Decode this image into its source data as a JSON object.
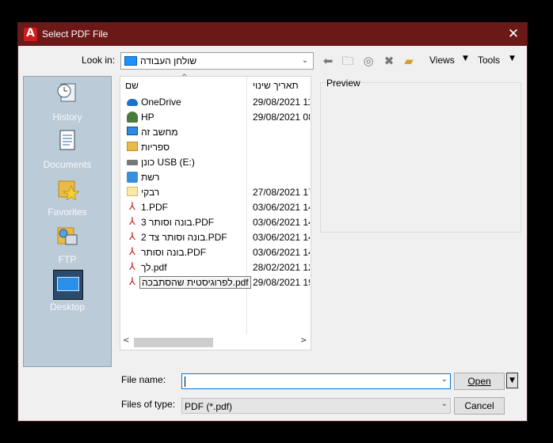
{
  "window": {
    "title": "Select PDF File",
    "close_glyph": "✕"
  },
  "toolbar": {
    "lookin_label": "Look in:",
    "lookin_value": "שולחן העבודה",
    "views_label": "Views",
    "tools_label": "Tools",
    "icons": [
      "back-icon",
      "up-folder-icon",
      "search-web-icon",
      "delete-icon",
      "new-folder-icon"
    ]
  },
  "places": [
    {
      "label": "History",
      "icon": "history-icon"
    },
    {
      "label": "Documents",
      "icon": "documents-icon"
    },
    {
      "label": "Favorites",
      "icon": "favorites-icon"
    },
    {
      "label": "FTP",
      "icon": "ftp-icon"
    },
    {
      "label": "Desktop",
      "icon": "desktop-icon",
      "selected": true
    }
  ],
  "filelist": {
    "col_name": "שם",
    "col_date": "תאריך שינוי",
    "rows": [
      {
        "name": "OneDrive",
        "date": "29/08/2021 11:",
        "icon": "cloud-icon"
      },
      {
        "name": "HP",
        "date": "29/08/2021 08:",
        "icon": "user-icon"
      },
      {
        "name": "מחשב זה",
        "date": "",
        "icon": "computer-icon"
      },
      {
        "name": "ספריות",
        "date": "",
        "icon": "library-icon"
      },
      {
        "name": "כונן USB (E:)",
        "date": "",
        "icon": "usb-drive-icon"
      },
      {
        "name": "רשת",
        "date": "",
        "icon": "network-icon"
      },
      {
        "name": "רבקי",
        "date": "27/08/2021 17:",
        "icon": "folder-icon"
      },
      {
        "name": "1.PDF",
        "date": "03/06/2021 14:",
        "icon": "pdf-icon"
      },
      {
        "name": "בונה וסותר 3.PDF",
        "date": "03/06/2021 14:",
        "icon": "pdf-icon"
      },
      {
        "name": "בונה וסותר צד 2.PDF",
        "date": "03/06/2021 14:",
        "icon": "pdf-icon"
      },
      {
        "name": "בונה וסותר.PDF",
        "date": "03/06/2021 14:",
        "icon": "pdf-icon"
      },
      {
        "name": "לך.pdf",
        "date": "28/02/2021 12:",
        "icon": "pdf-icon"
      },
      {
        "name": "לפרוגיסטית שהסתבכה.pdf",
        "date": "29/08/2021 19:",
        "icon": "pdf-icon",
        "tooltip": true
      }
    ]
  },
  "preview": {
    "label": "Preview"
  },
  "form": {
    "filename_label": "File name:",
    "filename_value": "",
    "filetype_label": "Files of type:",
    "filetype_value": "PDF (*.pdf)"
  },
  "buttons": {
    "open": "Open",
    "cancel": "Cancel"
  }
}
